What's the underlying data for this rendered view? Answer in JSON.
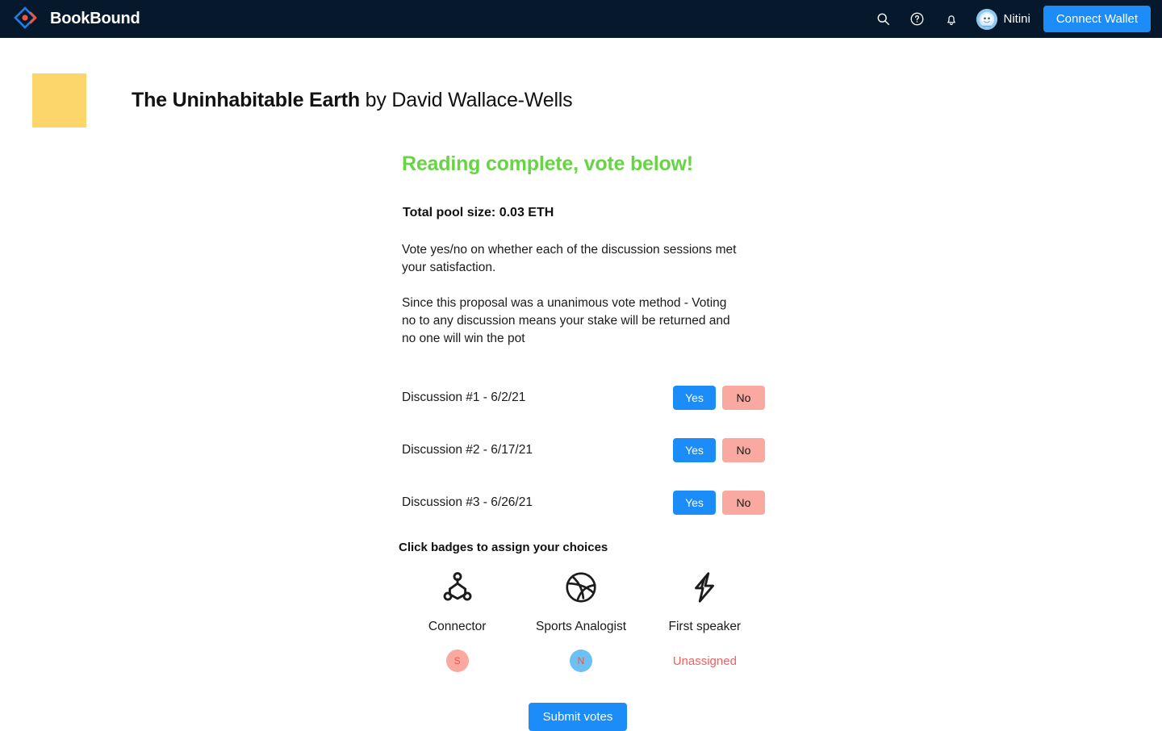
{
  "navbar": {
    "brand_name": "BookBound",
    "logo_icon": "diamond-dot-chevron-logo",
    "icons": [
      {
        "name": "search-icon",
        "label": "Search"
      },
      {
        "name": "help-icon",
        "label": "Help"
      },
      {
        "name": "notifications-bell-icon",
        "label": "Notifications"
      }
    ],
    "avatar_icon": "user-avatar",
    "username": "Nitini",
    "connect_wallet_label": "Connect Wallet",
    "background_color": "#05182c",
    "accent_color": "#1b8cf8"
  },
  "book": {
    "cover_color": "#fdd66b",
    "title": "The Uninhabitable Earth",
    "byline": " by David Wallace-Wells"
  },
  "vote_panel": {
    "status_heading": "Reading complete, vote below!",
    "status_color": "#66d443",
    "pool_size": "Total pool size: 0.03 ETH",
    "paragraph_1": "Vote yes/no on whether each of the discussion sessions met your satisfaction.",
    "paragraph_2": "Since this proposal was a unanimous vote method - Voting no to any discussion means your stake will be returned and no one will win the pot",
    "yes_label": "Yes",
    "no_label": "No",
    "yes_color": "#1b8cf8",
    "no_color": "#f9a99f",
    "discussions": [
      {
        "label": "Discussion #1 - 6/2/21"
      },
      {
        "label": "Discussion #2 - 6/17/21"
      },
      {
        "label": "Discussion #3 - 6/26/21"
      }
    ],
    "badges_title": "Click badges to assign your choices",
    "badges": [
      {
        "icon": "network-nodes-icon",
        "name": "Connector",
        "assignee": "S",
        "assignee_type": "initial",
        "assignee_color": "#f9a99f"
      },
      {
        "icon": "basketball-icon",
        "name": "Sports Analogist",
        "assignee": "N",
        "assignee_type": "initial",
        "assignee_color": "#6cc0f3"
      },
      {
        "icon": "lightning-bolt-icon",
        "name": "First speaker",
        "assignee": "Unassigned",
        "assignee_type": "unassigned",
        "assignee_color": "#fa5b5b"
      }
    ],
    "submit_label": "Submit votes"
  }
}
